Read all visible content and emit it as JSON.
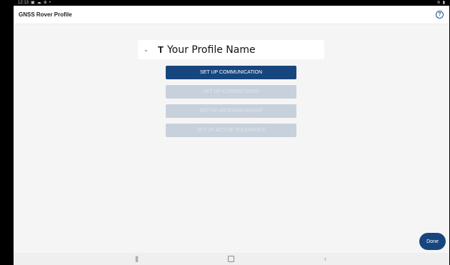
{
  "status_bar": {
    "time": "12:13",
    "left_icons": [
      "image-icon",
      "cloud-icon",
      "location-icon",
      "dot-icon"
    ],
    "right_icons": [
      "wifi-icon",
      "battery-icon"
    ]
  },
  "app_bar": {
    "title": "GNSS Rover Profile",
    "help_icon": "help-circle-icon",
    "help_glyph": "?"
  },
  "profile": {
    "chevron_glyph": "⌄",
    "pin_glyph": "T",
    "name": "Your Profile Name"
  },
  "actions": {
    "communication": "SET UP COMMUNICATION",
    "corrections": "SET UP CORRECTIONS",
    "antenna_height": "SET UP ANTENNA HEIGHT",
    "active_tolerance": "SET UP ACTIVE TOLERANCE"
  },
  "done_label": "Done",
  "nav_bar": {
    "recents_glyph": "|||",
    "back_glyph": "‹"
  },
  "colors": {
    "primary": "#17467f",
    "disabled": "#c7d1dc",
    "background": "#f5f5f5"
  }
}
